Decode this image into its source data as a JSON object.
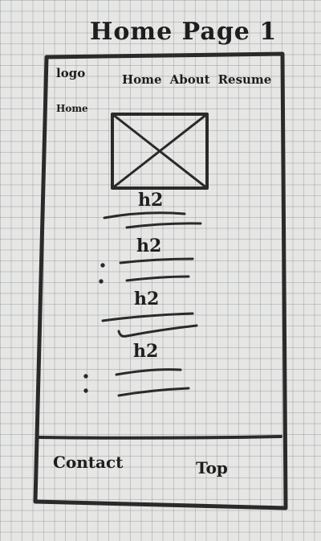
{
  "title": "Home Page 1",
  "header": {
    "logo": "logo",
    "subtitle": "Home",
    "nav": [
      "Home",
      "About",
      "Resume"
    ]
  },
  "sections": [
    {
      "heading": "h2"
    },
    {
      "heading": "h2"
    },
    {
      "heading": "h2"
    },
    {
      "heading": "h2"
    }
  ],
  "footer": {
    "contact": "Contact",
    "top": "Top"
  }
}
